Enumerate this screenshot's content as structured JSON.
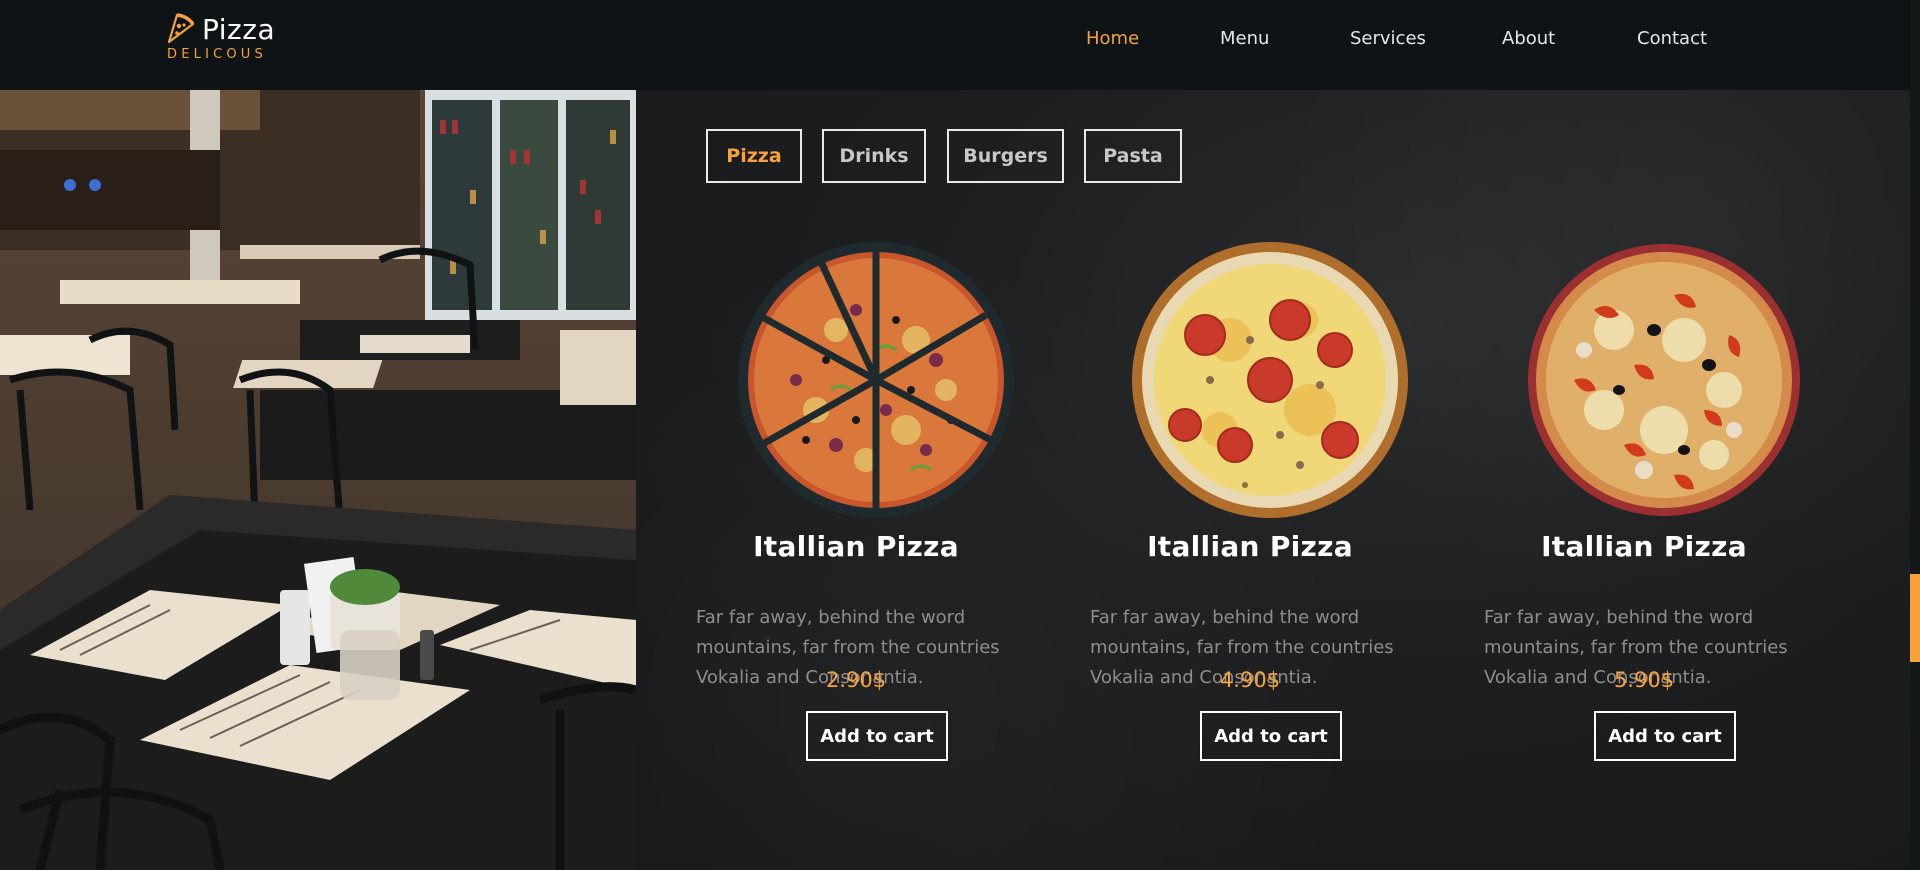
{
  "brand": {
    "name": "Pizza",
    "tagline": "DELICOUS"
  },
  "nav": {
    "items": [
      {
        "label": "Home",
        "active": true
      },
      {
        "label": "Menu",
        "active": false
      },
      {
        "label": "Services",
        "active": false
      },
      {
        "label": "About",
        "active": false
      },
      {
        "label": "Contact",
        "active": false
      }
    ]
  },
  "menu": {
    "tabs": [
      {
        "label": "Pizza",
        "active": true
      },
      {
        "label": "Drinks",
        "active": false
      },
      {
        "label": "Burgers",
        "active": false
      },
      {
        "label": "Pasta",
        "active": false
      }
    ],
    "items": [
      {
        "title": "Itallian Pizza",
        "description": "Far far away, behind the word mountains, far from the countries Vokalia and Consonantia.",
        "price": "2.90$",
        "button": "Add to cart"
      },
      {
        "title": "Itallian Pizza",
        "description": "Far far away, behind the word mountains, far from the countries Vokalia and Consonantia.",
        "price": "4.90$",
        "button": "Add to cart"
      },
      {
        "title": "Itallian Pizza",
        "description": "Far far away, behind the word mountains, far from the countries Vokalia and Consonantia.",
        "price": "5.90$",
        "button": "Add to cart"
      }
    ]
  },
  "colors": {
    "accent": "#f7a23b",
    "navbar": "#0e1316",
    "text_muted": "#8e8e8e"
  },
  "icons": {
    "brand": "pizza-slice-icon"
  }
}
